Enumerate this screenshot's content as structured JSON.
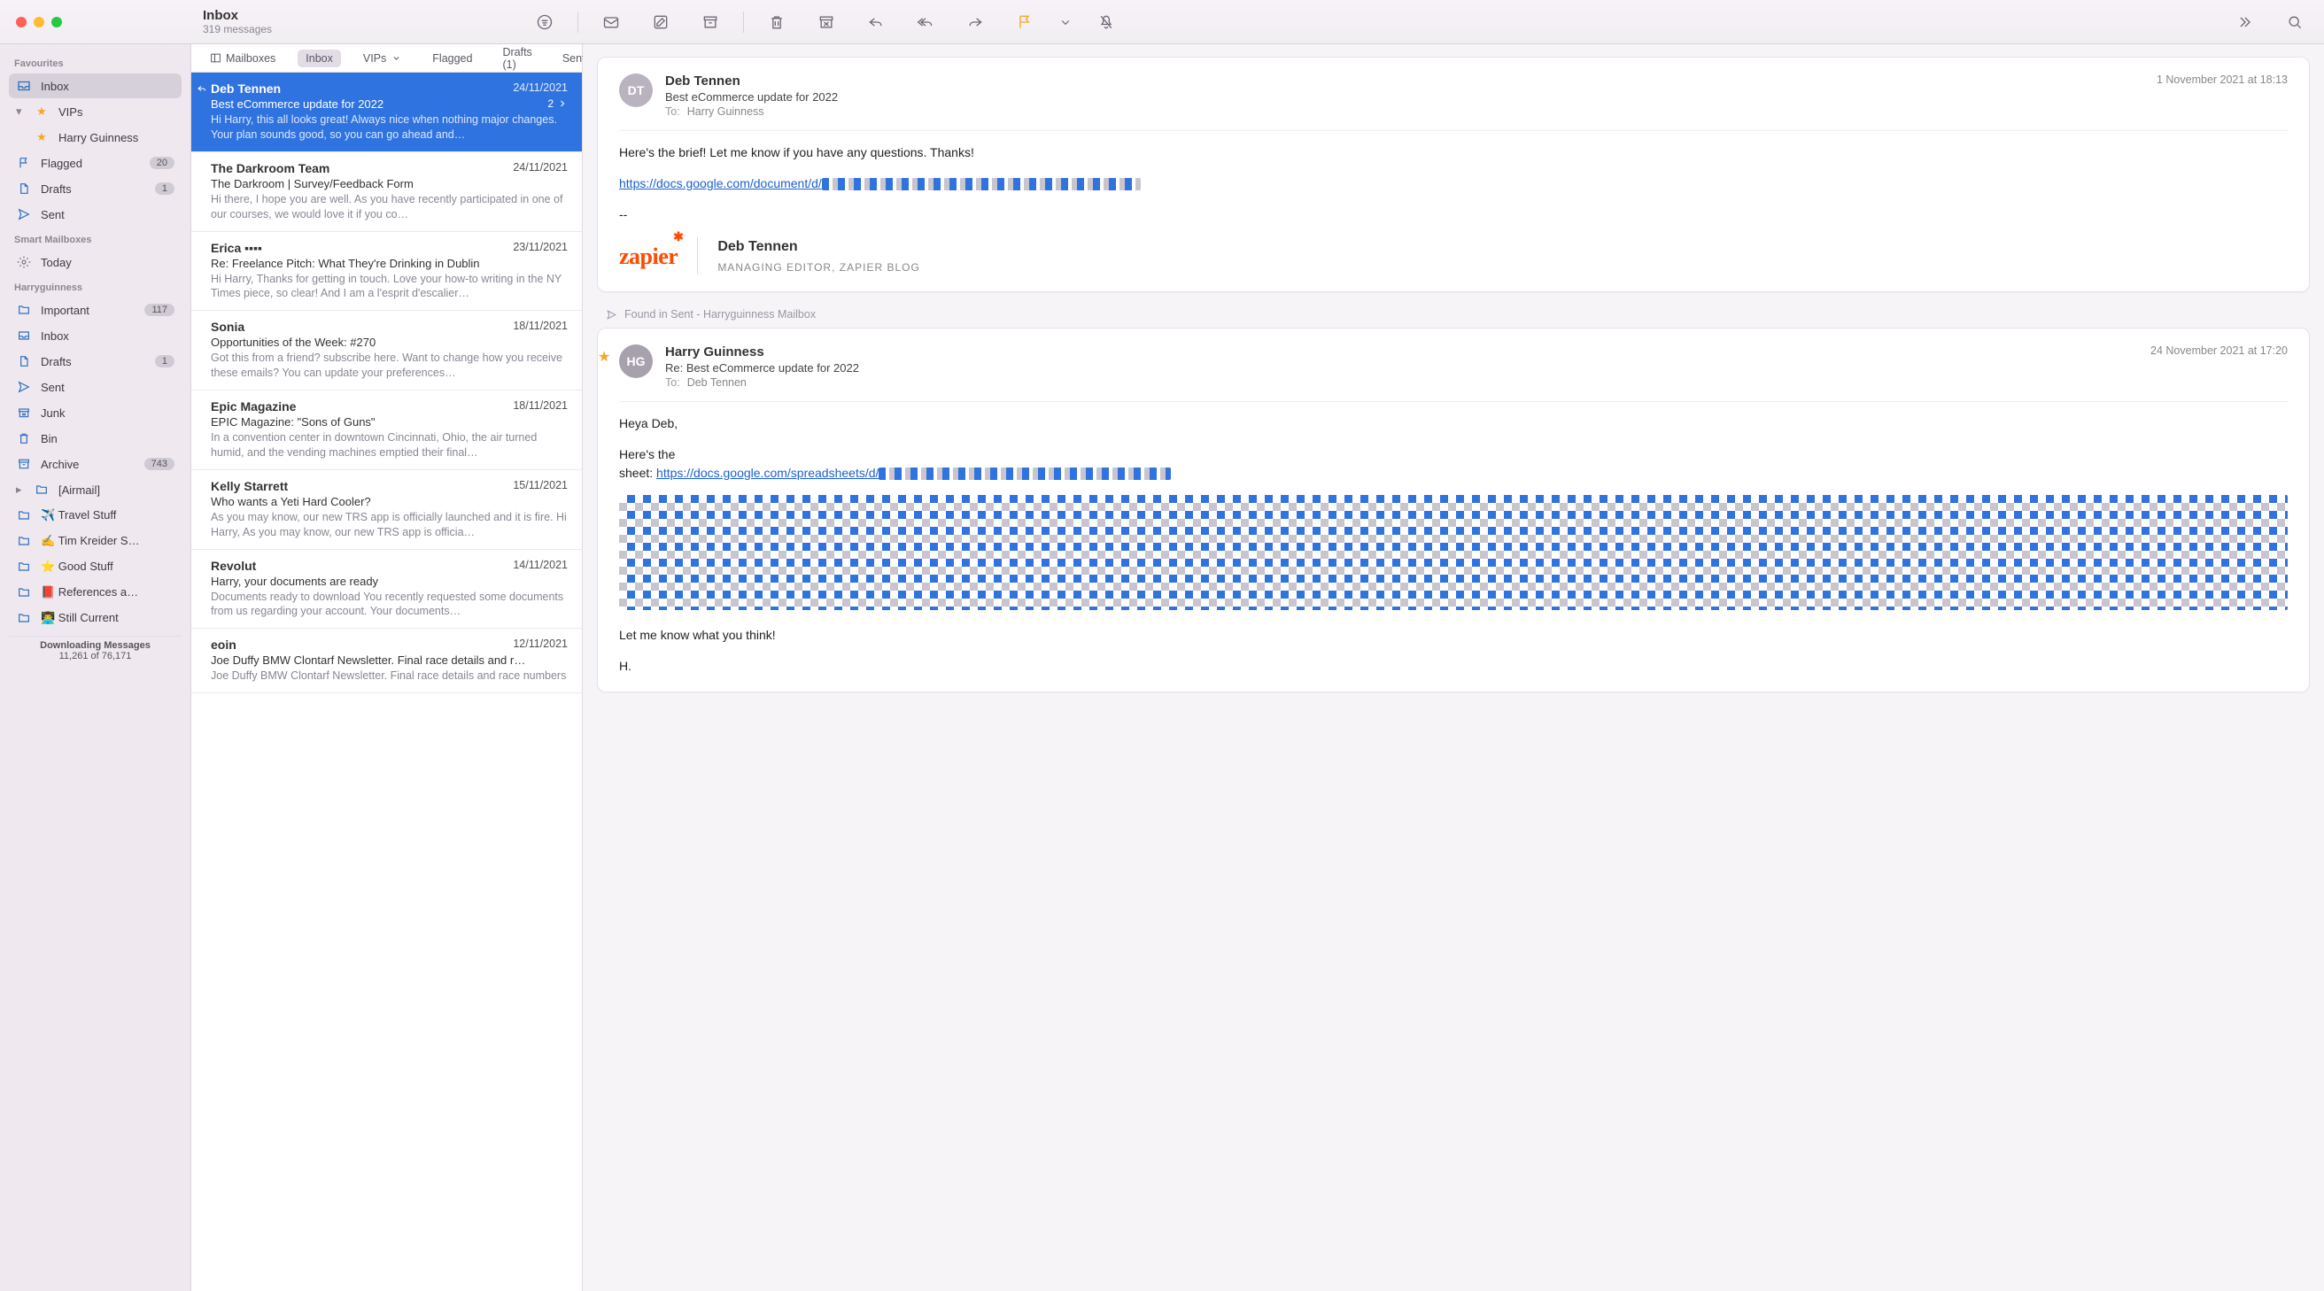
{
  "window": {
    "title": "Inbox",
    "subtitle": "319 messages"
  },
  "toolbar_icons": [
    "filter",
    "mail",
    "compose",
    "archive-box",
    "trash",
    "junk-box",
    "reply",
    "reply-all",
    "forward",
    "flag",
    "flag-menu",
    "mute",
    "more",
    "search"
  ],
  "favourites_bar": {
    "mailboxes": "Mailboxes",
    "items": [
      {
        "label": "Inbox",
        "active": true
      },
      {
        "label": "VIPs",
        "chevron": true
      },
      {
        "label": "Flagged"
      },
      {
        "label": "Drafts (1)"
      },
      {
        "label": "Sent"
      }
    ]
  },
  "sidebar": {
    "sections": [
      {
        "label": "Favourites",
        "items": [
          {
            "icon": "inbox",
            "label": "Inbox",
            "selected": true
          },
          {
            "icon": "star",
            "label": "VIPs",
            "disclosure": "open",
            "iconColor": "gold",
            "children": [
              {
                "icon": "star",
                "label": "Harry Guinness",
                "iconColor": "gold"
              }
            ]
          },
          {
            "icon": "flag",
            "label": "Flagged",
            "badge": "20"
          },
          {
            "icon": "doc",
            "label": "Drafts",
            "badge": "1"
          },
          {
            "icon": "send",
            "label": "Sent"
          }
        ]
      },
      {
        "label": "Smart Mailboxes",
        "items": [
          {
            "icon": "gear",
            "label": "Today",
            "iconColor": "grey"
          }
        ]
      },
      {
        "label": "Harryguinness",
        "items": [
          {
            "icon": "folder",
            "label": "Important",
            "badge": "117"
          },
          {
            "icon": "inbox",
            "label": "Inbox"
          },
          {
            "icon": "doc",
            "label": "Drafts",
            "badge": "1"
          },
          {
            "icon": "send",
            "label": "Sent"
          },
          {
            "icon": "junk",
            "label": "Junk"
          },
          {
            "icon": "trash",
            "label": "Bin"
          },
          {
            "icon": "archive",
            "label": "Archive",
            "badge": "743"
          },
          {
            "icon": "folder",
            "label": "[Airmail]",
            "disclosure": "closed"
          },
          {
            "icon": "folder",
            "label": "✈️ Travel Stuff"
          },
          {
            "icon": "folder",
            "label": "✍️ Tim Kreider S…"
          },
          {
            "icon": "folder",
            "label": "⭐ Good Stuff"
          },
          {
            "icon": "folder",
            "label": "📕 References a…"
          },
          {
            "icon": "folder",
            "label": "👨‍💻 Still Current"
          }
        ]
      }
    ],
    "status": {
      "line1": "Downloading Messages",
      "line2": "11,261 of 76,171"
    }
  },
  "messages": [
    {
      "from": "Deb Tennen",
      "date": "24/11/2021",
      "subject": "Best eCommerce update for 2022",
      "preview": "Hi Harry, this all looks great! Always nice when nothing major changes. Your plan sounds good, so you can go ahead and…",
      "selected": true,
      "thread_count": "2",
      "replied": true
    },
    {
      "from": "The Darkroom Team",
      "date": "24/11/2021",
      "subject": "The Darkroom | Survey/Feedback Form",
      "preview": "Hi there, I hope you are well.  As you have recently participated in one of our courses, we would love it if you co…"
    },
    {
      "from": "Erica ▪▪▪▪",
      "date": "23/11/2021",
      "subject": "Re: Freelance Pitch: What They're Drinking in Dublin",
      "preview": "Hi Harry, Thanks for getting in touch. Love your how-to writing in the NY Times piece, so clear! And I am a l'esprit d'escalier…"
    },
    {
      "from": "Sonia",
      "date": "18/11/2021",
      "subject": "Opportunities of the Week: #270",
      "preview": "Got this from a friend? subscribe here. Want to change how you receive these emails? You can update your preferences…"
    },
    {
      "from": "Epic Magazine",
      "date": "18/11/2021",
      "subject": "EPIC Magazine: \"Sons of Guns\"",
      "preview": "In a convention center in downtown Cincinnati, Ohio, the air turned humid, and the vending machines emptied their final…"
    },
    {
      "from": "Kelly Starrett",
      "date": "15/11/2021",
      "subject": "Who wants a Yeti Hard Cooler?",
      "preview": "As you may know, our new TRS app is officially launched and it is fire. Hi Harry, As you may know, our new TRS app is officia…"
    },
    {
      "from": "Revolut",
      "date": "14/11/2021",
      "subject": "Harry, your documents are ready",
      "preview": "Documents ready to download You recently requested some documents from us regarding your account. Your documents…"
    },
    {
      "from": "eoin",
      "date": "12/11/2021",
      "subject": "Joe Duffy BMW Clontarf Newsletter. Final race details and r…",
      "preview": "Joe Duffy BMW Clontarf Newsletter. Final race details and race numbers"
    }
  ],
  "thread": {
    "card1": {
      "initials": "DT",
      "from": "Deb Tennen",
      "date": "1 November 2021 at 18:13",
      "subject": "Best eCommerce update for 2022",
      "to_label": "To:",
      "to": "Harry Guinness",
      "line1": "Here's the brief! Let me know if you have any questions. Thanks!",
      "link": "https://docs.google.com/document/d/",
      "dashes": "--",
      "sig_brand": "zapier",
      "sig_name": "Deb Tennen",
      "sig_role": "MANAGING EDITOR, ZAPIER BLOG"
    },
    "found_in": "Found in Sent - Harryguinness Mailbox",
    "card2": {
      "initials": "HG",
      "from": "Harry Guinness",
      "date": "24 November 2021 at 17:20",
      "subject": "Re: Best eCommerce update for 2022",
      "to_label": "To:",
      "to": "Deb Tennen",
      "starred": true,
      "greeting": "Heya Deb,",
      "sheet_intro": "Here's the\nsheet: ",
      "sheet_link": "https://docs.google.com/spreadsheets/d/",
      "closing": "Let me know what you think!",
      "signoff": "H."
    }
  }
}
